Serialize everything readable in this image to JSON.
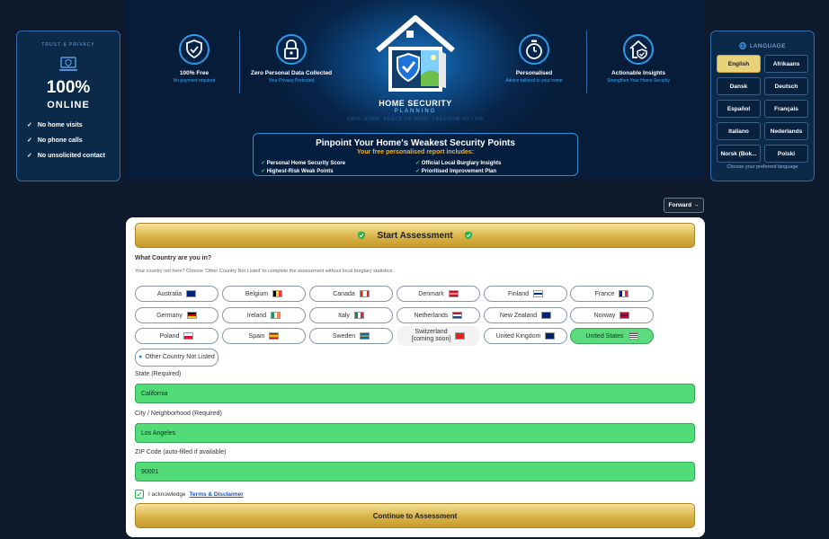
{
  "trust": {
    "title": "TRUST & PRIVACY",
    "big": "100%",
    "online": "ONLINE",
    "items": [
      "No home visits",
      "No phone calls",
      "No unsolicited contact"
    ]
  },
  "features": [
    {
      "title": "100% Free",
      "sub": "No payment required",
      "icon": "shield-check-icon"
    },
    {
      "title": "Zero Personal Data Collected",
      "sub": "Your Privacy Protected",
      "icon": "lock-icon"
    },
    {
      "title": "Personalised",
      "sub": "Advice tailored to your home",
      "icon": "stopwatch-icon"
    },
    {
      "title": "Actionable Insights",
      "sub": "Strengthen Your Home Security",
      "icon": "house-shield-icon"
    }
  ],
  "brand": {
    "name": "HOME SECURITY",
    "sub": "PLANNING",
    "tagline": "SAFE HOME, PEACE OF MIND, FREEDOM TO LIVE"
  },
  "report": {
    "title": "Pinpoint Your Home's Weakest Security Points",
    "subtitle": "Your free personalised report includes:",
    "items": [
      "Personal Home Security Score",
      "Official Local Burglary Insights",
      "Highest-Risk Weak Points",
      "Prioritised Improvement Plan"
    ]
  },
  "language": {
    "title": "LANGUAGE",
    "options": [
      "English",
      "Afrikaans",
      "Dansk",
      "Deutsch",
      "Español",
      "Français",
      "Italiano",
      "Nederlands",
      "Norsk (Bok...",
      "Polski"
    ],
    "selected": "English",
    "footer": "Choose your preferred language"
  },
  "forward_label": "Forward →",
  "assessment": {
    "title": "Start Assessment",
    "question": "What Country are you in?",
    "note": "Your country not here? Choose 'Other Country Not Listed' to complete the assessment without local burglary statistics.",
    "countries": [
      "Australia",
      "Belgium",
      "Canada",
      "Denmark",
      "Finland",
      "France",
      "Germany",
      "Ireland",
      "Italy",
      "Netherlands",
      "New Zealand",
      "Norway",
      "Poland",
      "Spain",
      "Sweden",
      "Switzerland",
      "United Kingdom",
      "United States"
    ],
    "coming_soon": "[coming soon]",
    "other": "Other Country Not Listed",
    "selected_country": "United States",
    "state_label": "State (Required)",
    "state_value": "California",
    "city_label": "City / Neighborhood (Required)",
    "city_value": "Los Angeles",
    "zip_label": "ZIP Code (auto-filled if available)",
    "zip_value": "90001",
    "ack_text": "I acknowledge",
    "ack_link": "Terms & Disclaimer",
    "continue_label": "Continue to Assessment"
  },
  "colors": {
    "accent": "#2e9be6",
    "gold": "#d8b347",
    "selected_green": "#52dc78",
    "background": "#0e1a2b"
  }
}
